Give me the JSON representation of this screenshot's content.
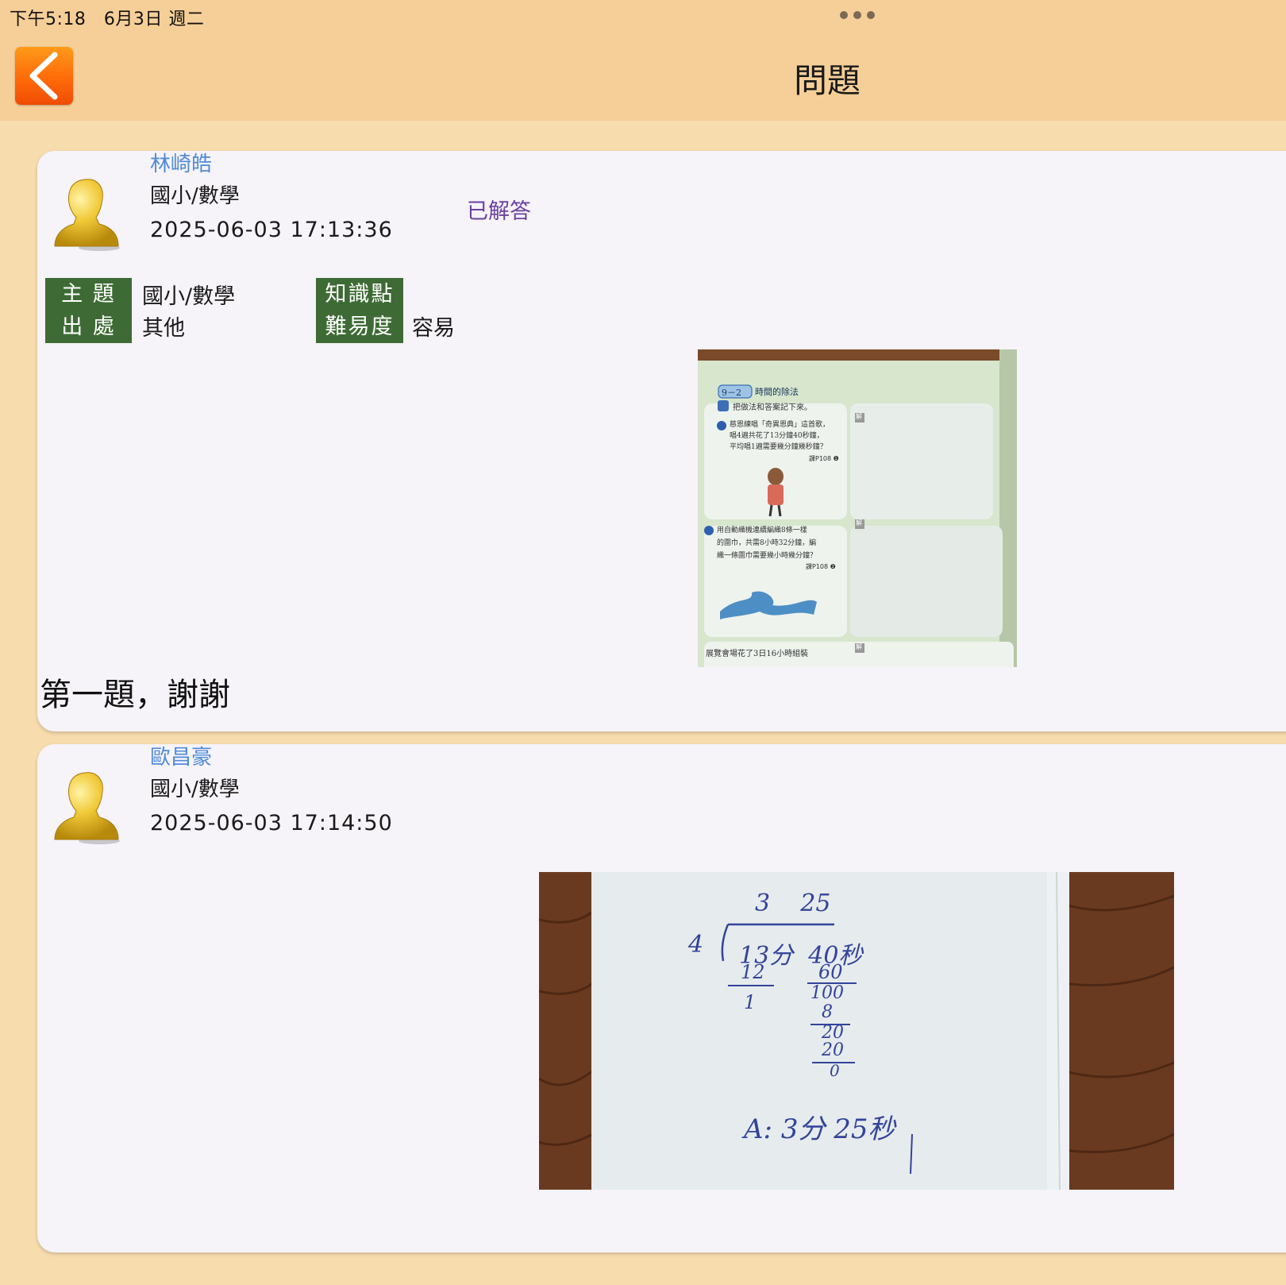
{
  "status_bar": {
    "time": "下午5:18",
    "date": "6月3日 週二"
  },
  "header": {
    "title": "問題",
    "back_icon": "chevron-left-icon"
  },
  "posts": [
    {
      "user": "林崎皓",
      "subject": "國小/數學",
      "timestamp": "2025-06-03 17:13:36",
      "status": "已解答",
      "meta": {
        "topic_label": "主 題",
        "topic_value": "國小/數學",
        "source_label": "出 處",
        "source_value": "其他",
        "knowledge_label": "知識點",
        "knowledge_value": "",
        "difficulty_label": "難易度",
        "difficulty_value": "容易"
      },
      "image": {
        "section": "9－2",
        "section_title": "時間的除法",
        "instruction": "把做法和答案記下來。",
        "q1": [
          "慈恩練唱「奇異恩典」這首歌，",
          "唱4遍共花了13分鐘40秒鐘，",
          "平均唱1遍需要幾分鐘幾秒鐘？"
        ],
        "q1_ref": "課P108 ❶",
        "q2": [
          "用自動織機連續編織8條一樣",
          "的圍巾，共需8小時32分鐘，編",
          "織一條圍巾需要幾小時幾分鐘？"
        ],
        "q2_ref": "課P108 ❷",
        "q3": "展覽會場花了3日16小時組裝",
        "solve_tag": "解"
      },
      "text": "第一題，謝謝"
    },
    {
      "user": "歐昌豪",
      "subject": "國小/數學",
      "timestamp": "2025-06-03 17:14:50",
      "image": {
        "quotient": "3    25",
        "divisor": "4",
        "dividend": "13分  40秒",
        "step1": "12",
        "step2": "1",
        "step3": "60",
        "step4": "100",
        "step5": "8",
        "step6": "20",
        "step7": "20",
        "step8": "0",
        "answer": "A: 3分 25秒"
      }
    }
  ],
  "colors": {
    "header_bg": "#f6cf98",
    "page_bg": "#f7dcae",
    "card_bg": "#f6f3f9",
    "name_blue": "#4f8bd6",
    "status_purple": "#6a3fa0",
    "label_green": "#3e6b35",
    "back_orange": "#ff6a08"
  }
}
